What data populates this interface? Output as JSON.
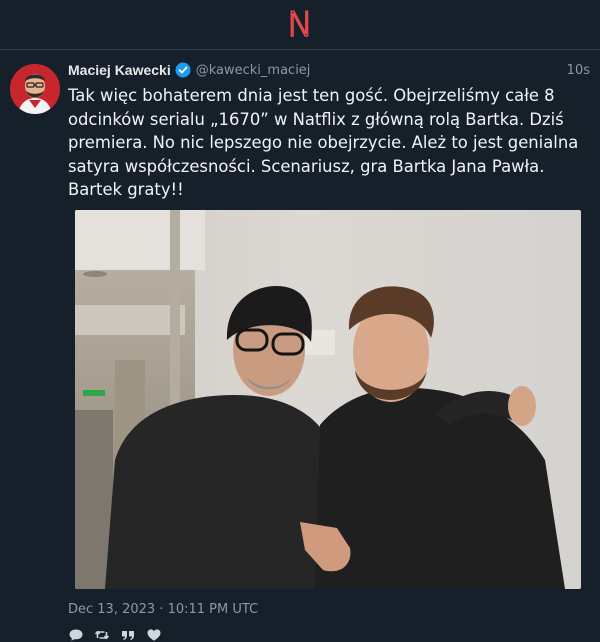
{
  "app": {
    "logo_letter": "N",
    "accent_color": "#e5484d"
  },
  "tweet": {
    "author_name": "Maciej Kawecki",
    "author_handle": "@kawecki_maciej",
    "verified": true,
    "relative_time": "10s",
    "text": "Tak więc bohaterem dnia jest ten gość. Obejrzeliśmy całe 8 odcinków serialu „1670” w Natflix z główną rolą Bartka. Dziś premiera. No nic lepszego nie obejrzycie. Ależ to jest genialna satyra współczesności. Scenariusz, gra Bartka Jana Pawła. Bartek graty!!",
    "date": "Dec 13, 2023 · 10:11 PM UTC"
  },
  "actions": {
    "icons": [
      "reply-icon",
      "retweet-icon",
      "quote-icon",
      "like-icon"
    ]
  }
}
